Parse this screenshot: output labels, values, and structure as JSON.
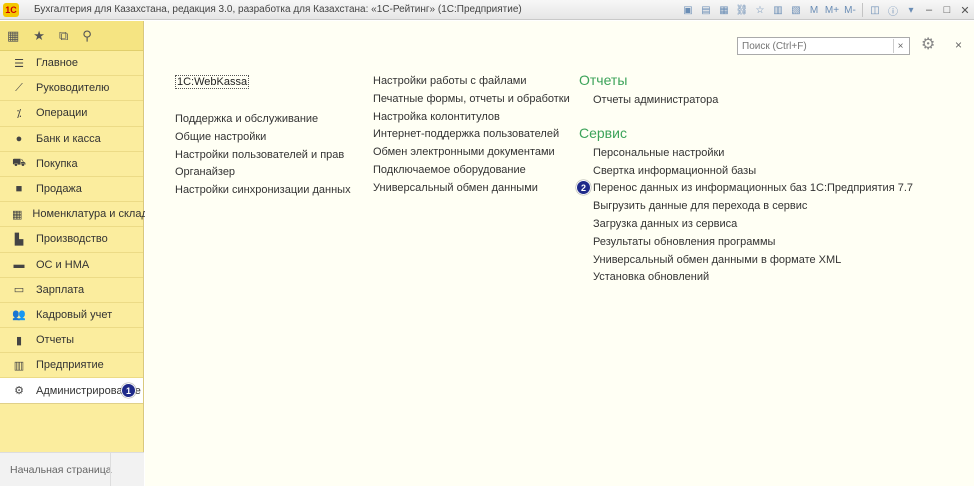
{
  "window": {
    "title": "Бухгалтерия для Казахстана, редакция 3.0, разработка для Казахстана: «1С-Рейтинг» (1С:Предприятие)",
    "logo_text": "1С"
  },
  "sidebar": {
    "items": [
      {
        "label": "Главное",
        "icon": "menu-lines-icon"
      },
      {
        "label": "Руководителю",
        "icon": "trend-chart-icon"
      },
      {
        "label": "Операции",
        "icon": "operations-icon"
      },
      {
        "label": "Банк и касса",
        "icon": "coins-icon"
      },
      {
        "label": "Покупка",
        "icon": "cart-icon"
      },
      {
        "label": "Продажа",
        "icon": "bag-icon"
      },
      {
        "label": "Номенклатура и склад",
        "icon": "grid-icon"
      },
      {
        "label": "Производство",
        "icon": "factory-icon"
      },
      {
        "label": "ОС и НМА",
        "icon": "truck-icon"
      },
      {
        "label": "Зарплата",
        "icon": "wallet-icon"
      },
      {
        "label": "Кадровый учет",
        "icon": "people-icon"
      },
      {
        "label": "Отчеты",
        "icon": "bar-chart-icon"
      },
      {
        "label": "Предприятие",
        "icon": "building-icon"
      },
      {
        "label": "Администрирование",
        "icon": "gear-icon"
      }
    ],
    "active_marker": "1",
    "home_tab": "Начальная страница"
  },
  "search": {
    "placeholder": "Поиск (Ctrl+F)"
  },
  "content": {
    "col1": {
      "webkassa": "1C:WebKassa",
      "links": [
        "Поддержка и обслуживание",
        "Общие настройки",
        "Настройки пользователей и прав",
        "Органайзер",
        "Настройки синхронизации данных"
      ]
    },
    "col2": {
      "links": [
        "Настройки работы с файлами",
        "Печатные формы, отчеты и обработки",
        "Настройка колонтитулов",
        "Интернет-поддержка пользователей",
        "Обмен электронными документами",
        "Подключаемое оборудование",
        "Универсальный обмен данными"
      ]
    },
    "reports": {
      "title": "Отчеты",
      "links": [
        "Отчеты администратора"
      ]
    },
    "service": {
      "title": "Сервис",
      "links": [
        "Персональные настройки",
        "Свертка информационной базы",
        "Перенос данных из информационных баз 1С:Предприятия 7.7",
        "Выгрузить данные для перехода в сервис",
        "Загрузка данных из сервиса",
        "Результаты обновления программы",
        "Универсальный обмен данными в формате XML",
        "Установка обновлений"
      ],
      "marker": "2"
    }
  }
}
